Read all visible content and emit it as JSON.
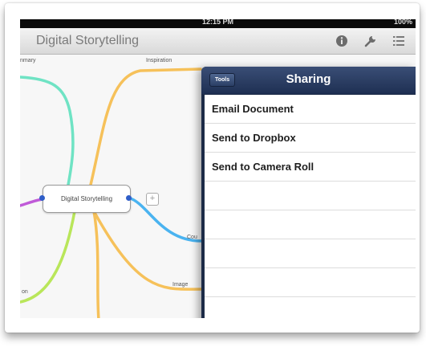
{
  "status_bar": {
    "time": "12:15 PM",
    "battery": "100%"
  },
  "navbar": {
    "title": "Digital Storytelling",
    "icons": [
      "info-icon",
      "wrench-icon",
      "list-icon"
    ]
  },
  "mindmap": {
    "central_node": "Digital Storytelling",
    "branches": [
      "Inspiration",
      "Cou",
      "Image",
      "nmary",
      "on"
    ]
  },
  "popover": {
    "back_label": "Tools",
    "title": "Sharing",
    "items": [
      "Email Document",
      "Send to Dropbox",
      "Send to Camera Roll"
    ]
  },
  "colors": {
    "popover_header": "#2a3d63",
    "branch_orange": "#f6c15a",
    "branch_teal": "#6fe3c4",
    "branch_blue": "#4ab3f0",
    "branch_green": "#b9e65a",
    "branch_purple": "#c05ad8",
    "handle_blue": "#2f5ec8"
  }
}
